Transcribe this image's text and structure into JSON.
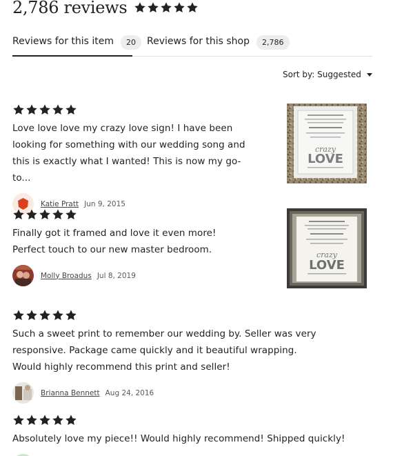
{
  "header": {
    "count_label": "2,786 reviews",
    "rating_stars": 5
  },
  "tabs": [
    {
      "label": "Reviews for this item",
      "count": "20",
      "active": true
    },
    {
      "label": "Reviews for this shop",
      "count": "2,786",
      "active": false
    }
  ],
  "sort": {
    "label": "Sort by: Suggested"
  },
  "colors": {
    "star": "#222222",
    "tab_underline": "#222222",
    "badge_bg": "#ededed"
  },
  "reviews": [
    {
      "stars": 5,
      "text": "Love love love my crazy love sign! I have been looking for something with our wedding song and this is exactly what I wanted! This is now my go-to...",
      "reviewer": "Katie Pratt",
      "date": "Jun 9, 2015",
      "avatar": "red-hexagon-avatar",
      "has_photo": true,
      "photo": {
        "words_top": "crazy",
        "word_main": "LOVE"
      }
    },
    {
      "stars": 5,
      "text": "Finally got it framed and love it even more! Perfect touch to our new master bedroom.",
      "reviewer": "Molly Broadus",
      "date": "Jul 8, 2019",
      "avatar": "couple-photo-avatar",
      "has_photo": true,
      "photo": {
        "words_top": "crazy",
        "word_main": "LOVE"
      }
    },
    {
      "stars": 5,
      "text": "Such a sweet print to remember our wedding by. Seller was very responsive. Package came quickly and it beautiful wrapping. Would highly recommend this print and seller!",
      "reviewer": "Brianna Bennett",
      "date": "Aug 24, 2016",
      "avatar": "photo-avatar",
      "has_photo": false
    },
    {
      "stars": 5,
      "text": "Absolutely love my piece!! Would highly recommend! Shipped quickly!",
      "reviewer": "",
      "date": "",
      "avatar": "green-avatar",
      "has_photo": false
    }
  ]
}
